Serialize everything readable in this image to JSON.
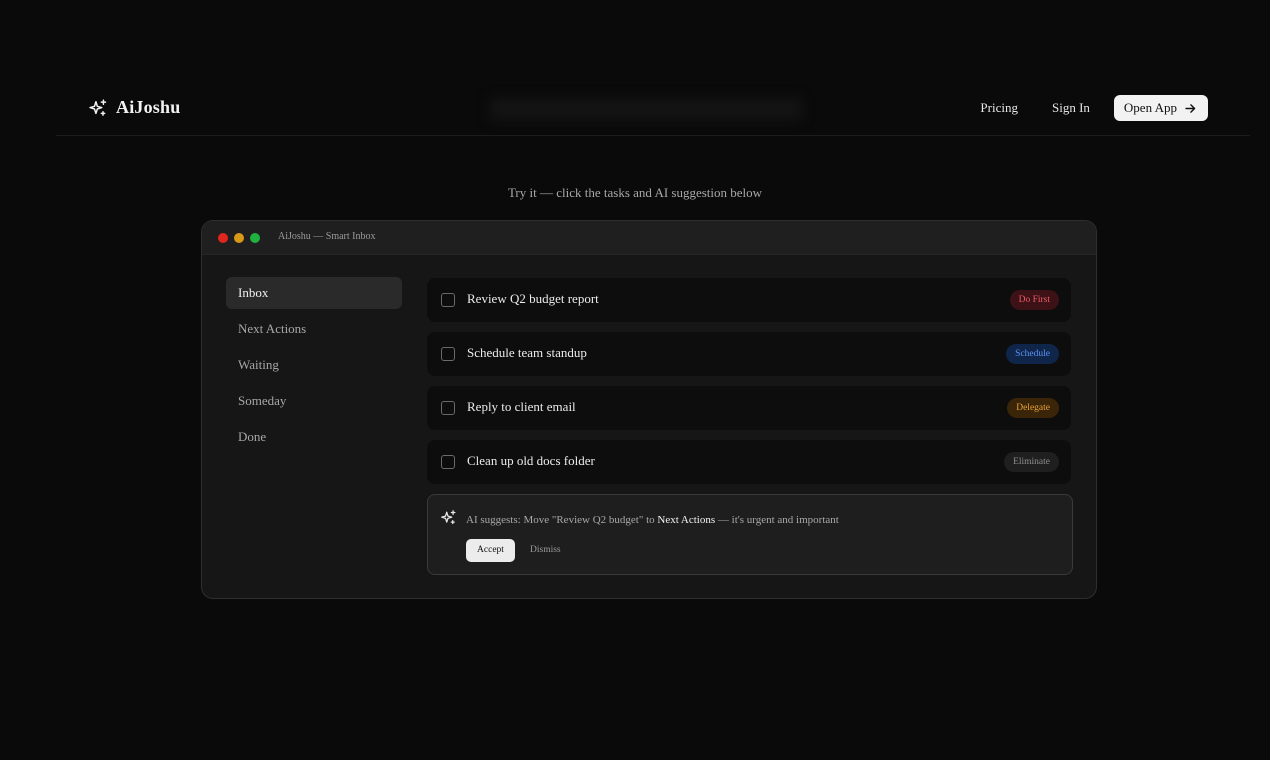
{
  "header": {
    "brand_name": "AiJoshu",
    "nav": {
      "pricing": "Pricing",
      "sign_in": "Sign In",
      "open_app": "Open App"
    }
  },
  "hero": {
    "tagline": "Try it — click the tasks and AI suggestion below"
  },
  "window": {
    "title": "AiJoshu — Smart Inbox",
    "sidebar": [
      {
        "label": "Inbox",
        "active": true
      },
      {
        "label": "Next Actions",
        "active": false
      },
      {
        "label": "Waiting",
        "active": false
      },
      {
        "label": "Someday",
        "active": false
      },
      {
        "label": "Done",
        "active": false
      }
    ],
    "tasks": [
      {
        "title": "Review Q2 budget report",
        "badge": "Do First",
        "checked": false
      },
      {
        "title": "Schedule team standup",
        "badge": "Schedule",
        "checked": false
      },
      {
        "title": "Reply to client email",
        "badge": "Delegate",
        "checked": false
      },
      {
        "title": "Clean up old docs folder",
        "badge": "Eliminate",
        "checked": false
      }
    ],
    "suggestion": {
      "prefix": "AI suggests: Move \"Review Q2 budget\" to ",
      "target": "Next Actions",
      "suffix": " — it's urgent and important",
      "accept": "Accept",
      "dismiss": "Dismiss"
    }
  },
  "colors": {
    "background": "#0a0a0a",
    "do_first": "#ef5b67",
    "schedule": "#5a95f5",
    "delegate": "#e8a23a",
    "eliminate": "#8f8f8f"
  }
}
